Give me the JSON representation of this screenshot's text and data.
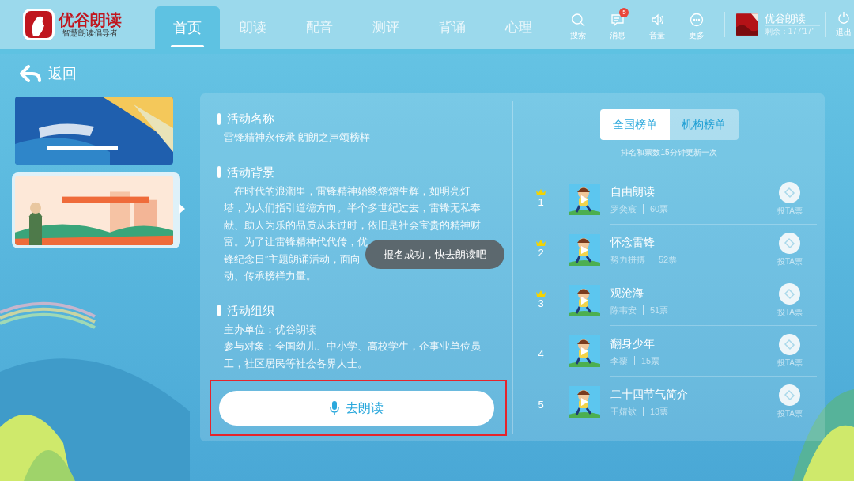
{
  "app": {
    "logo_text": "优谷朗读",
    "logo_slogan": "智慧朗读倡导者"
  },
  "tabs": [
    {
      "label": "首页",
      "selected": true
    },
    {
      "label": "朗读",
      "selected": false
    },
    {
      "label": "配音",
      "selected": false
    },
    {
      "label": "测评",
      "selected": false
    },
    {
      "label": "背诵",
      "selected": false
    },
    {
      "label": "心理",
      "selected": false
    }
  ],
  "toolbar": [
    {
      "kind": "search",
      "label": "搜索"
    },
    {
      "kind": "message",
      "label": "消息",
      "badge": "5"
    },
    {
      "kind": "volume",
      "label": "音量"
    },
    {
      "kind": "more",
      "label": "更多"
    }
  ],
  "user": {
    "name": "优谷朗读",
    "remaining": "剩余：177'17\""
  },
  "logout": "退出",
  "back": "返回",
  "banners": [
    {
      "selected": false
    },
    {
      "selected": true
    }
  ],
  "sections": [
    {
      "kind": "plain",
      "title": "活动名称",
      "lines": [
        "雷锋精神永传承 朗朗之声颂榜样"
      ]
    },
    {
      "kind": "paragraph",
      "title": "活动背景",
      "lines": [
        "在时代的浪潮里，雷锋精神始终熠熠生辉，如明亮灯",
        "塔，为人们指引道德方向。半个多世纪过去，雷锋无私奉",
        "献、助人为乐的品质从未过时，依旧是社会宝贵的精神财",
        "富。为了让雷锋精神代代传，优",
        "锋纪念日”主题朗诵活动，面向",
        "动、传承榜样力量。"
      ]
    },
    {
      "kind": "plain",
      "title": "活动组织",
      "lines": [
        "主办单位：优谷朗读",
        "参与对象：全国幼儿、中小学、高校学生，企事业单位员",
        "工，社区居民等社会各界人士。"
      ]
    }
  ],
  "toast": "报名成功，快去朗读吧",
  "read_button": "去朗读",
  "ranking_tabs": [
    {
      "label": "全国榜单",
      "selected": true
    },
    {
      "label": "机构榜单",
      "selected": false
    }
  ],
  "ranking_note": "排名和票数15分钟更新一次",
  "entries": [
    {
      "rank": "1",
      "crowned": true,
      "title": "自由朗读",
      "author": "罗奕宸",
      "votes": "60票",
      "vote_label": "投TA票"
    },
    {
      "rank": "2",
      "crowned": true,
      "title": "怀念雷锋",
      "author": "努力拼搏",
      "votes": "52票",
      "vote_label": "投TA票"
    },
    {
      "rank": "3",
      "crowned": true,
      "title": "观沧海",
      "author": "陈韦安",
      "votes": "51票",
      "vote_label": "投TA票"
    },
    {
      "rank": "4",
      "crowned": false,
      "title": "翻身少年",
      "author": "李藜",
      "votes": "15票",
      "vote_label": "投TA票"
    },
    {
      "rank": "5",
      "crowned": false,
      "title": "二十四节气简介",
      "author": "王婧钦",
      "votes": "13票",
      "vote_label": "投TA票"
    }
  ]
}
